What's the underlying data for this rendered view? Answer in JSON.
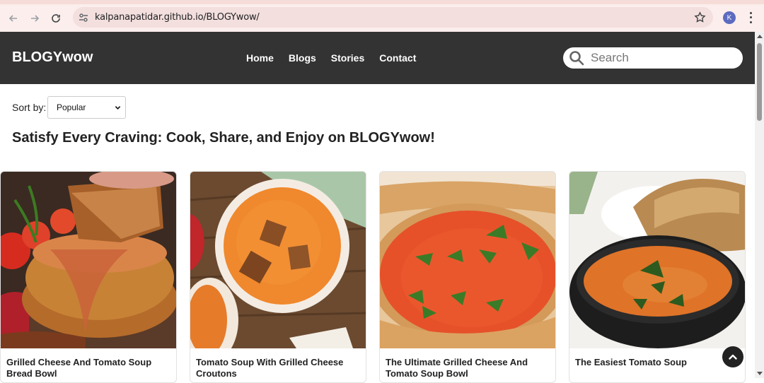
{
  "browser": {
    "url": "kalpanapatidar.github.io/BLOGYwow/",
    "profile_initial": "K"
  },
  "header": {
    "logo": "BLOGYwow",
    "nav": [
      "Home",
      "Blogs",
      "Stories",
      "Contact"
    ],
    "search_placeholder": "Search"
  },
  "sort": {
    "label": "Sort by:",
    "selected": "Popular"
  },
  "headline": "Satisfy Every Craving: Cook, Share, and Enjoy on BLOGYwow!",
  "cards": [
    {
      "title": "Grilled Cheese And Tomato Soup Bread Bowl"
    },
    {
      "title": "Tomato Soup With Grilled Cheese Croutons"
    },
    {
      "title": "The Ultimate Grilled Cheese And Tomato Soup Bowl"
    },
    {
      "title": "The Easiest Tomato Soup"
    }
  ],
  "colors": {
    "header_bg": "#333333",
    "soup": "#e8742a"
  }
}
